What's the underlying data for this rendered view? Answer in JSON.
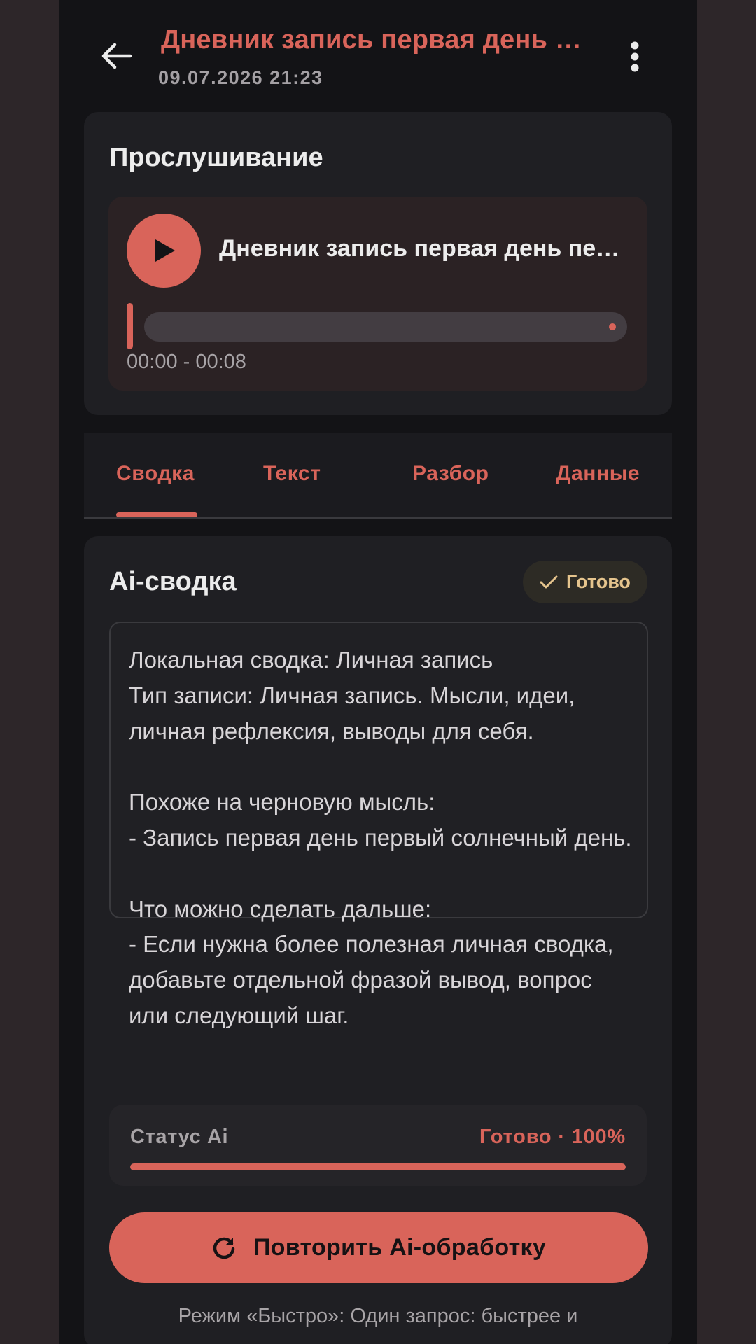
{
  "header": {
    "title": "Дневник запись первая день первый солнечный день",
    "datetime": "09.07.2026 21:23",
    "back_icon": "arrow-left-icon",
    "menu_icon": "more-vertical-icon"
  },
  "player_card": {
    "heading": "Прослушивание",
    "track_name": "Дневник запись первая день первый солнечный день",
    "time_range": "00:00 - 00:08",
    "position_fraction": 0.0,
    "play_icon": "play-icon"
  },
  "tabs": [
    {
      "label": "Сводка",
      "active": true
    },
    {
      "label": "Текст",
      "active": false
    },
    {
      "label": "Разбор",
      "active": false
    },
    {
      "label": "Данные",
      "active": false
    }
  ],
  "summary": {
    "heading": "Ai-сводка",
    "badge_label": "Готово",
    "badge_icon": "check-icon",
    "text": "Локальная сводка: Личная запись\nТип записи: Личная запись. Мысли, идеи, личная рефлексия, выводы для себя.\n\nПохоже на черновую мысль:\n- Запись первая день первый солнечный день.\n\nЧто можно сделать дальше:\n- Если нужна более полезная личная сводка, добавьте отдельной фразой вывод, вопрос или следующий шаг."
  },
  "status": {
    "label": "Статус Ai",
    "value": "Готово · 100%",
    "progress": 1.0
  },
  "retry_button": {
    "label": "Повторить Ai-обработку",
    "icon": "refresh-icon"
  },
  "mode_note": "Режим «Быстро»: Один запрос: быстрее и",
  "colors": {
    "accent": "#d9645a",
    "background": "#131316",
    "card": "#1f1f23",
    "badge_text": "#e5c48d"
  }
}
